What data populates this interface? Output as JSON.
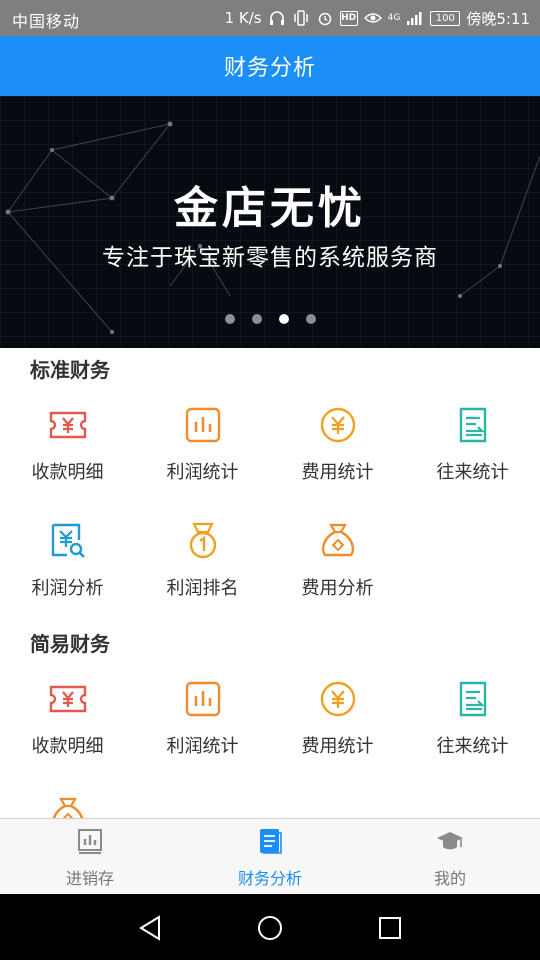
{
  "status_bar": {
    "carrier": "中国移动",
    "speed": "1 K/s",
    "network": "4G",
    "battery": "100",
    "time": "傍晚5:11"
  },
  "header": {
    "title": "财务分析"
  },
  "banner": {
    "headline": "金店无忧",
    "subtitle": "专注于珠宝新零售的系统服务商",
    "slide_count": 4,
    "active_slide": 3
  },
  "sections": [
    {
      "title": "标准财务",
      "items": [
        {
          "label": "收款明细",
          "icon": "ticket-yen-icon",
          "color": "#e05a4e"
        },
        {
          "label": "利润统计",
          "icon": "bar-chart-icon",
          "color": "#f08c2e"
        },
        {
          "label": "费用统计",
          "icon": "yen-coin-icon",
          "color": "#f0a020"
        },
        {
          "label": "往来统计",
          "icon": "transfer-doc-icon",
          "color": "#2bb5a8"
        },
        {
          "label": "利润分析",
          "icon": "yen-search-icon",
          "color": "#1e9bd8"
        },
        {
          "label": "利润排名",
          "icon": "medal-icon",
          "color": "#f0a020"
        },
        {
          "label": "费用分析",
          "icon": "money-bag-icon",
          "color": "#f08c2e"
        }
      ]
    },
    {
      "title": "简易财务",
      "items": [
        {
          "label": "收款明细",
          "icon": "ticket-yen-icon",
          "color": "#e05a4e"
        },
        {
          "label": "利润统计",
          "icon": "bar-chart-icon",
          "color": "#f08c2e"
        },
        {
          "label": "费用统计",
          "icon": "yen-coin-icon",
          "color": "#f0a020"
        },
        {
          "label": "往来统计",
          "icon": "transfer-doc-icon",
          "color": "#2bb5a8"
        },
        {
          "label": "",
          "icon": "money-bag-icon",
          "color": "#f08c2e"
        }
      ]
    }
  ],
  "tabs": [
    {
      "label": "进销存",
      "icon": "inventory-chart-icon",
      "active": false
    },
    {
      "label": "财务分析",
      "icon": "finance-book-icon",
      "active": true
    },
    {
      "label": "我的",
      "icon": "graduation-cap-icon",
      "active": false
    }
  ],
  "colors": {
    "primary": "#1b8ef7",
    "status_bar": "#7f7f7f",
    "banner_bg": "#070a10",
    "tab_inactive": "#777777"
  }
}
